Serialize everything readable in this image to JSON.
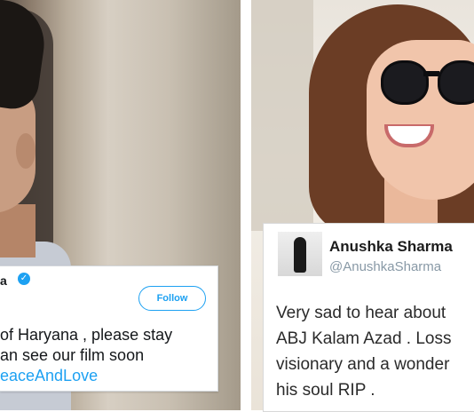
{
  "left_tweet": {
    "name": "a",
    "follow_label": "Follow",
    "lines": [
      "of Haryana , please stay",
      "an see our film soon"
    ],
    "hashtag": "eaceAndLove"
  },
  "right_tweet": {
    "name": "Anushka Sharma",
    "handle": "@AnushkaSharma",
    "lines": [
      "Very sad to hear about",
      "ABJ Kalam Azad . Loss",
      "visionary and a wonder",
      "his soul RIP ."
    ]
  },
  "icons": {
    "verified": "verified-badge-icon",
    "check_glyph": "✓"
  },
  "colors": {
    "twitter_blue": "#1da1f2",
    "handle_gray": "#8899a6"
  }
}
